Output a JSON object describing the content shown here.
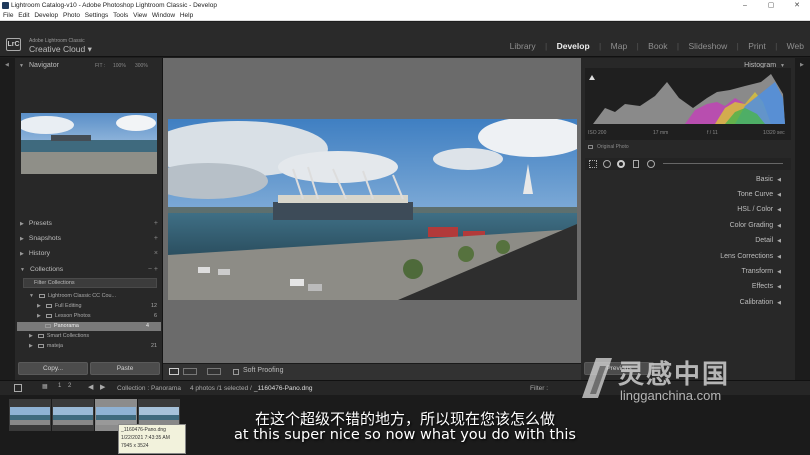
{
  "window": {
    "title": "Lightroom Catalog-v10 - Adobe Photoshop Lightroom Classic - Develop",
    "controls": [
      "–",
      "▢",
      "✕"
    ]
  },
  "menu": [
    "File",
    "Edit",
    "Develop",
    "Photo",
    "Settings",
    "Tools",
    "View",
    "Window",
    "Help"
  ],
  "identity": {
    "logo": "LrC",
    "sub": "Adobe Lightroom Classic",
    "main": "Creative Cloud ▾"
  },
  "modules": [
    "Library",
    "Develop",
    "Map",
    "Book",
    "Slideshow",
    "Print",
    "Web"
  ],
  "active_module": "Develop",
  "left": {
    "navigator": {
      "title": "Navigator",
      "fit": "FIT :",
      "z1": "100%",
      "z2": "300%"
    },
    "panels": [
      {
        "label": "Presets",
        "plus": "+"
      },
      {
        "label": "Snapshots",
        "plus": "+"
      },
      {
        "label": "History",
        "plus": "×"
      },
      {
        "label": "Collections",
        "plus": "− +"
      }
    ],
    "filter": "Filter Collections",
    "collections": [
      {
        "label": "Lightroom Classic CC Cou...",
        "count": ""
      },
      {
        "label": "Full Editing",
        "count": "12"
      },
      {
        "label": "Lesson Photos",
        "count": "6"
      },
      {
        "label": "Panorama",
        "count": "4"
      },
      {
        "label": "Smart Collections",
        "count": ""
      },
      {
        "label": "mateja",
        "count": "21"
      }
    ],
    "copy": "Copy...",
    "paste": "Paste"
  },
  "toolbar": {
    "soft_proofing": "Soft Proofing"
  },
  "right": {
    "histogram": "Histogram",
    "iso": "ISO 200",
    "focal": "17 mm",
    "aperture": "f / 11",
    "shutter": "1/320 sec",
    "original": "Original Photo",
    "panels": [
      "Basic",
      "Tone Curve",
      "HSL / Color",
      "Color Grading",
      "Detail",
      "Lens Corrections",
      "Transform",
      "Effects",
      "Calibration"
    ],
    "previous": "Previous"
  },
  "filmbar": {
    "page1": "1",
    "page2": "2",
    "collection": "Collection : Panorama",
    "info": "4 photos /1 selected /",
    "file": "_1160476-Pano.dng",
    "filter": "Filter :"
  },
  "filmstrip": {
    "tooltip_file": "_1160476-Pano.dng",
    "tooltip_date": "1/22/2021 7:43:35 AM",
    "tooltip_size": "7945 x 3524"
  },
  "subtitles": {
    "cn": "在这个超级不错的地方，所以现在您该怎么做",
    "en": "at this super nice so now what you do with this"
  },
  "watermark": {
    "cn": "灵感中国",
    "en": "lingganchina.com"
  }
}
